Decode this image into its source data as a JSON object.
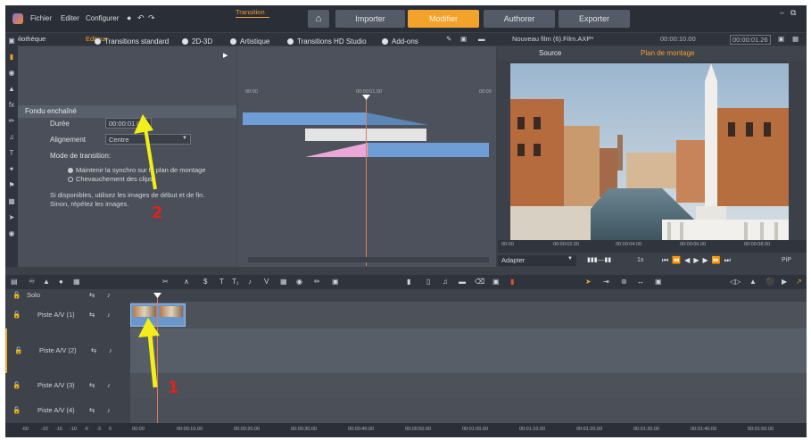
{
  "menu": {
    "fichier": "Fichier",
    "editer": "Editer",
    "configurer": "Configurer"
  },
  "nav": {
    "importer": "Importer",
    "modifier": "Modifier",
    "authorer": "Authorer",
    "exporter": "Exporter"
  },
  "library": {
    "bibliotheque": "Bibliothèque",
    "editeur": "Editeur"
  },
  "editor": {
    "tab_transition": "Transition",
    "categories": [
      "Transitions standard",
      "2D-3D",
      "Artistique",
      "Transitions HD Studio",
      "Add-ons"
    ],
    "section": "Fondu enchaîné",
    "duree_label": "Durée",
    "duree_value": "00:00:01.00",
    "alignement_label": "Alignement",
    "alignement_value": "Centre",
    "mode_label": "Mode de transition:",
    "radio1": "Maintenir la synchro sur le plan de montage",
    "radio2": "Chevauchement des clips",
    "note1": "Si disponibles, utilisez les images de début et de fin.",
    "note2": "Sinon, répétez les images.",
    "ruler": [
      "00:00",
      "00:00:01.00",
      "00:00"
    ],
    "annotation_2": "2"
  },
  "preview": {
    "title": "Nouveau film (6).Film.AXP*",
    "time1": "00:00:10.00",
    "time2": "00:00:01.26",
    "tab_source": "Source",
    "tab_plan": "Plan de montage",
    "ruler": [
      "00:00",
      "00:00:02.00",
      "00:00:04.00",
      "00:00:06.00",
      "00:00:08.00"
    ],
    "adapter": "Adapter",
    "speed": "1x",
    "pip": "PiP"
  },
  "tracks": [
    {
      "name": "Solo"
    },
    {
      "name": "Piste A/V (1)"
    },
    {
      "name": "Piste A/V (2)"
    },
    {
      "name": "Piste A/V (3)"
    },
    {
      "name": "Piste A/V (4)"
    }
  ],
  "timeline": {
    "annotation_1": "1",
    "ruler": [
      "00:00",
      "00:00:10.00",
      "00:00:20.00",
      "00:00:30.00",
      "00:00:40.00",
      "00:00:50.00",
      "00:01:00.00",
      "00:01:10.00",
      "00:01:20.00",
      "00:01:30.00",
      "00:01:40.00",
      "00:01:50.00"
    ],
    "levels": [
      "-60",
      "-22",
      "-16",
      "-10",
      "-6",
      "-3",
      "0"
    ]
  },
  "colors": {
    "accent": "#f3a22c",
    "annotation_arrow": "#f2ee1a",
    "annotation_number": "#e0231b"
  }
}
